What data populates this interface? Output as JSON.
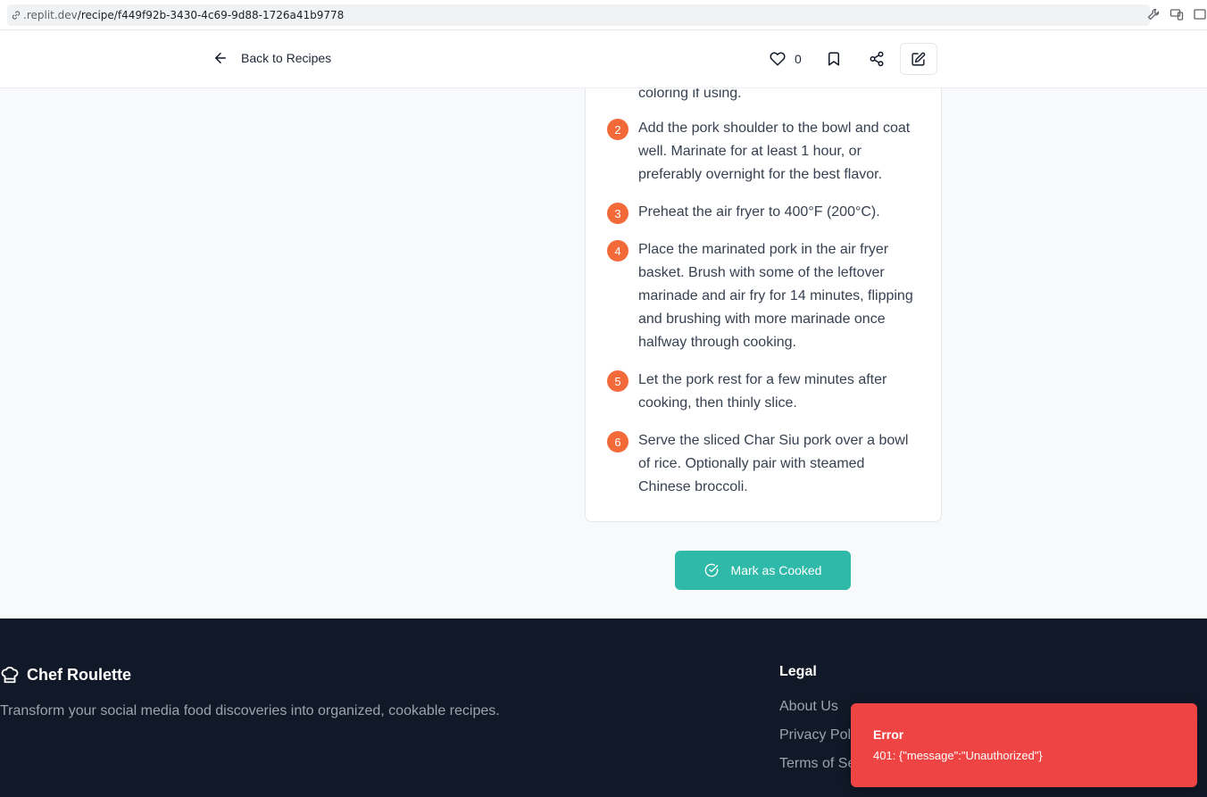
{
  "browser": {
    "url_host": ".replit.dev",
    "url_path": "/recipe/f449f92b-3430-4c69-9d88-1726a41b9778"
  },
  "header": {
    "back_label": "Back to Recipes",
    "like_count": "0"
  },
  "instructions": {
    "partial_text": "coloring if using.",
    "steps": [
      {
        "number": "2",
        "text": "Add the pork shoulder to the bowl and coat well. Marinate for at least 1 hour, or preferably overnight for the best flavor."
      },
      {
        "number": "3",
        "text": "Preheat the air fryer to 400°F (200°C)."
      },
      {
        "number": "4",
        "text": "Place the marinated pork in the air fryer basket. Brush with some of the leftover marinade and air fry for 14 minutes, flipping and brushing with more marinade once halfway through cooking."
      },
      {
        "number": "5",
        "text": "Let the pork rest for a few minutes after cooking, then thinly slice."
      },
      {
        "number": "6",
        "text": "Serve the sliced Char Siu pork over a bowl of rice. Optionally pair with steamed Chinese broccoli."
      }
    ]
  },
  "actions": {
    "mark_cooked_label": "Mark as Cooked"
  },
  "footer": {
    "brand": "Chef Roulette",
    "tagline": "Transform your social media food discoveries into organized, cookable recipes.",
    "legal_title": "Legal",
    "links": [
      "About Us",
      "Privacy Policy",
      "Terms of Service"
    ]
  },
  "toast": {
    "title": "Error",
    "message": "401: {\"message\":\"Unauthorized\"}"
  },
  "colors": {
    "step_badge": "#f26a3a",
    "primary_button": "#2fb9a9",
    "footer_bg": "#111827",
    "toast_bg": "#ef4444"
  },
  "icons": [
    "link-icon",
    "wrench-icon",
    "devices-icon",
    "arrow-left-icon",
    "heart-icon",
    "bookmark-icon",
    "share-icon",
    "edit-icon",
    "check-circle-icon",
    "chef-hat-icon"
  ]
}
